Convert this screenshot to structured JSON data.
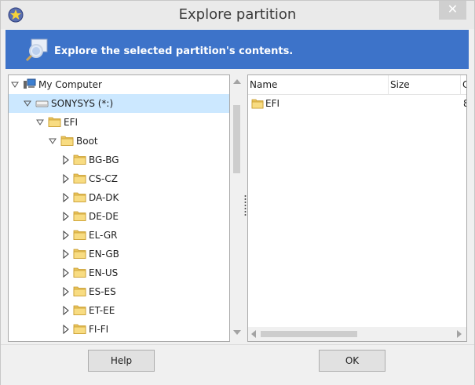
{
  "window": {
    "title": "Explore partition"
  },
  "banner": {
    "text": "Explore the selected partition's contents."
  },
  "tree": {
    "items": [
      {
        "label": "My Computer",
        "depth": 0,
        "icon": "computer-icon",
        "expander": "expanded"
      },
      {
        "label": "SONYSYS (*:)",
        "depth": 1,
        "icon": "drive-icon",
        "expander": "expanded",
        "selected": true
      },
      {
        "label": "EFI",
        "depth": 2,
        "icon": "folder-icon",
        "expander": "expanded"
      },
      {
        "label": "Boot",
        "depth": 3,
        "icon": "folder-icon",
        "expander": "expanded"
      },
      {
        "label": "BG-BG",
        "depth": 4,
        "icon": "folder-icon",
        "expander": "collapsed"
      },
      {
        "label": "CS-CZ",
        "depth": 4,
        "icon": "folder-icon",
        "expander": "collapsed"
      },
      {
        "label": "DA-DK",
        "depth": 4,
        "icon": "folder-icon",
        "expander": "collapsed"
      },
      {
        "label": "DE-DE",
        "depth": 4,
        "icon": "folder-icon",
        "expander": "collapsed"
      },
      {
        "label": "EL-GR",
        "depth": 4,
        "icon": "folder-icon",
        "expander": "collapsed"
      },
      {
        "label": "EN-GB",
        "depth": 4,
        "icon": "folder-icon",
        "expander": "collapsed"
      },
      {
        "label": "EN-US",
        "depth": 4,
        "icon": "folder-icon",
        "expander": "collapsed"
      },
      {
        "label": "ES-ES",
        "depth": 4,
        "icon": "folder-icon",
        "expander": "collapsed"
      },
      {
        "label": "ET-EE",
        "depth": 4,
        "icon": "folder-icon",
        "expander": "collapsed"
      },
      {
        "label": "FI-FI",
        "depth": 4,
        "icon": "folder-icon",
        "expander": "collapsed"
      }
    ]
  },
  "list": {
    "columns": [
      "Name",
      "Size",
      "C"
    ],
    "rows": [
      {
        "name": "EFI",
        "size": "",
        "extra": "8"
      }
    ]
  },
  "buttons": {
    "help": "Help",
    "ok": "OK"
  },
  "colors": {
    "banner": "#3d73c9",
    "selection": "#cce8ff"
  }
}
